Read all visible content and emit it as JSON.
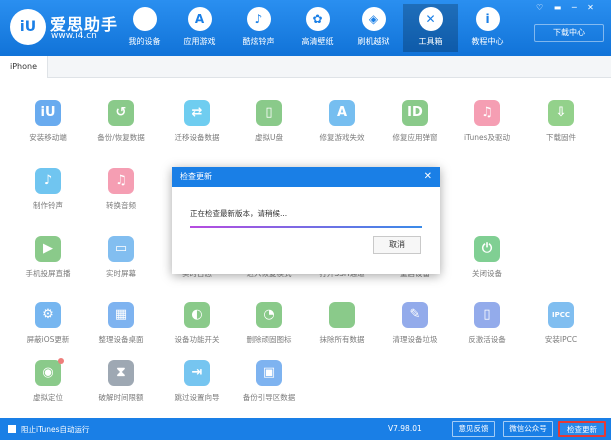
{
  "header": {
    "logo_glyph": "iU",
    "brand": "爱思助手",
    "site": "www.i4.cn",
    "download_center": "下载中心",
    "window_controls": "♡ ▬ ─ ✕",
    "nav": [
      {
        "label": "我的设备",
        "icon": "apple-icon",
        "glyph": ""
      },
      {
        "label": "应用游戏",
        "icon": "app-store-icon",
        "glyph": "A"
      },
      {
        "label": "酷炫铃声",
        "icon": "bell-icon",
        "glyph": "♪"
      },
      {
        "label": "高清壁纸",
        "icon": "flower-icon",
        "glyph": "✿"
      },
      {
        "label": "刷机越狱",
        "icon": "box-icon",
        "glyph": "◈"
      },
      {
        "label": "工具箱",
        "icon": "tools-icon",
        "glyph": "✕"
      },
      {
        "label": "教程中心",
        "icon": "info-icon",
        "glyph": "i"
      }
    ]
  },
  "tab": "iPhone",
  "items": [
    {
      "label": "安装移动端",
      "icon": "iu-logo-icon",
      "glyph": "iU",
      "color": "#1a7fe6"
    },
    {
      "label": "备份/恢复数据",
      "icon": "backup-clock-icon",
      "glyph": "↺",
      "color": "#4cae4c"
    },
    {
      "label": "迁移设备数据",
      "icon": "migrate-icon",
      "glyph": "⇄",
      "color": "#22b3e8"
    },
    {
      "label": "虚拟U盘",
      "icon": "usb-icon",
      "glyph": "▯",
      "color": "#4cae4c"
    },
    {
      "label": "修复游戏失效",
      "icon": "app-store-icon",
      "glyph": "A",
      "color": "#2d9be8"
    },
    {
      "label": "修复应用弹窗",
      "icon": "apple-id-icon",
      "glyph": "ID",
      "color": "#4cae4c"
    },
    {
      "label": "iTunes及驱动",
      "icon": "itunes-icon",
      "glyph": "♫",
      "color": "#f06a8a"
    },
    {
      "label": "下载固件",
      "icon": "firmware-icon",
      "glyph": "⇩",
      "color": "#59b94e"
    },
    {
      "label": "制作铃声",
      "icon": "bell-icon",
      "glyph": "♪",
      "color": "#24a6e8"
    },
    {
      "label": "转换音频",
      "icon": "music-icon",
      "glyph": "♫",
      "color": "#f06a8a"
    },
    {
      "label": "手机投屏直播",
      "icon": "screen-cast-icon",
      "glyph": "▶",
      "color": "#4cae4c"
    },
    {
      "label": "实时屏幕",
      "icon": "monitor-icon",
      "glyph": "▭",
      "color": "#3f9be8"
    },
    {
      "label": "实时日志",
      "icon": "log-icon",
      "glyph": "≡",
      "color": "#8a6bd8"
    },
    {
      "label": "进入恢复模式",
      "icon": "recovery-icon",
      "glyph": "⚙",
      "color": "#3a8be8"
    },
    {
      "label": "打开SSH通道",
      "icon": "ssh-icon",
      "glyph": ">",
      "color": "#4cae4c"
    },
    {
      "label": "重启设备",
      "icon": "restart-icon",
      "glyph": "↻",
      "color": "#2aa3e0"
    },
    {
      "label": "关闭设备",
      "icon": "power-icon",
      "glyph": "⏻",
      "color": "#3cb55a"
    },
    {
      "label": "屏蔽iOS更新",
      "icon": "block-update-icon",
      "glyph": "⚙",
      "color": "#2d8fe8"
    },
    {
      "label": "整理设备桌面",
      "icon": "desktop-grid-icon",
      "glyph": "▦",
      "color": "#3a8be8"
    },
    {
      "label": "设备功能开关",
      "icon": "toggle-icon",
      "glyph": "◐",
      "color": "#4cae4c"
    },
    {
      "label": "删除顽固图标",
      "icon": "delete-icon",
      "glyph": "◔",
      "color": "#4cae4c"
    },
    {
      "label": "抹除所有数据",
      "icon": "erase-apple-icon",
      "glyph": "",
      "color": "#4cae4c"
    },
    {
      "label": "清理设备垃圾",
      "icon": "broom-icon",
      "glyph": "✎",
      "color": "#5a7fe0"
    },
    {
      "label": "反激活设备",
      "icon": "deactivate-icon",
      "glyph": "▯",
      "color": "#5a7fe0"
    },
    {
      "label": "安装IPCC",
      "icon": "ipcc-icon",
      "glyph": "IPCC",
      "color": "#3d9be8"
    },
    {
      "label": "虚拟定位",
      "icon": "location-pin-icon",
      "glyph": "◉",
      "color": "#4cae4c"
    },
    {
      "label": "破解时间限额",
      "icon": "hourglass-icon",
      "glyph": "⧗",
      "color": "#6a7a8a"
    },
    {
      "label": "跳过设置向导",
      "icon": "skip-guide-icon",
      "glyph": "⇥",
      "color": "#2da6e8"
    },
    {
      "label": "备份引导区数据",
      "icon": "boot-backup-icon",
      "glyph": "▣",
      "color": "#3a8be8"
    }
  ],
  "dialog": {
    "title": "检查更新",
    "message": "正在检查最新版本，请稍候...",
    "progress": 1.0,
    "cancel": "取消"
  },
  "status": {
    "checkbox_label": "阻止iTunes自动运行",
    "version": "V7.98.01",
    "feedback": "意见反馈",
    "wechat": "微信公众号",
    "check_update": "检查更新"
  }
}
